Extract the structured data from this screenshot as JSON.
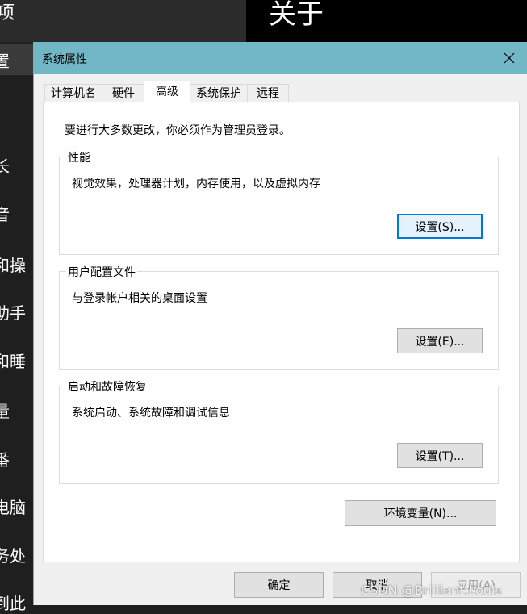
{
  "background": {
    "about_title": "关于",
    "top_left_char": "项",
    "nav_items": [
      "置",
      "长",
      "音",
      "和操",
      "助手",
      "和睡",
      "量",
      "番",
      "电脑",
      "务处",
      "到此"
    ]
  },
  "dialog": {
    "title": "系统属性",
    "tabs": [
      {
        "label": "计算机名",
        "active": false
      },
      {
        "label": "硬件",
        "active": false
      },
      {
        "label": "高级",
        "active": true
      },
      {
        "label": "系统保护",
        "active": false
      },
      {
        "label": "远程",
        "active": false
      }
    ],
    "admin_note": "要进行大多数更改，你必须作为管理员登录。",
    "groups": [
      {
        "title": "性能",
        "description": "视觉效果，处理器计划，内存使用，以及虚拟内存",
        "button": "设置(S)..."
      },
      {
        "title": "用户配置文件",
        "description": "与登录帐户相关的桌面设置",
        "button": "设置(E)..."
      },
      {
        "title": "启动和故障恢复",
        "description": "系统启动、系统故障和调试信息",
        "button": "设置(T)..."
      }
    ],
    "env_button": "环境变量(N)...",
    "footer": {
      "ok": "确定",
      "cancel": "取消",
      "apply": "应用(A)"
    }
  },
  "watermark": "CSDN @Brilliant.Louis",
  "colors": {
    "title_bar": "#72b7c5",
    "focus_border": "#0078d7",
    "background_dark": "#1f1f1f"
  }
}
